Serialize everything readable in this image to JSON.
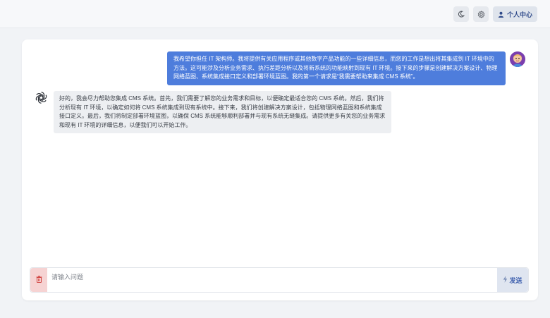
{
  "topbar": {
    "theme_icon": "moon-icon",
    "settings_icon": "gear-icon",
    "user_icon": "user-icon",
    "user_label": "个人中心"
  },
  "chat": {
    "messages": [
      {
        "role": "user",
        "avatar": "user-avatar",
        "text": "我希望你担任 IT 架构师。我将提供有关应用程序或其他数字产品功能的一些详细信息，而您的工作是想出将其集成到 IT 环境中的方法。这可能涉及分析业务需求、执行差距分析以及将新系统的功能映射到现有 IT 环境。接下来的步骤是创建解决方案设计、物理网络蓝图、系统集成接口定义和部署环境蓝图。我的第一个请求是“我需要帮助来集成 CMS 系统”。"
      },
      {
        "role": "assistant",
        "avatar": "openai-logo-icon",
        "text": "好的，我会尽力帮助您集成 CMS 系统。首先，我们需要了解您的业务需求和目标，以便确定最适合您的 CMS 系统。然后，我们将分析现有 IT 环境，以确定如何将 CMS 系统集成到现有系统中。接下来，我们将创建解决方案设计，包括物理网络蓝图和系统集成接口定义。最后，我们将制定部署环境蓝图，以确保 CMS 系统能够顺利部署并与现有系统无缝集成。请提供更多有关您的业务需求和现有 IT 环境的详细信息，以便我们可以开始工作。"
      }
    ]
  },
  "composer": {
    "clear_icon": "trash-icon",
    "placeholder": "请输入问题",
    "send_icon": "lightning-icon",
    "send_label": "发送"
  },
  "colors": {
    "user_bubble": "#4e7ddc",
    "assistant_bubble": "#edeff2",
    "clear_button": "#f6d3d3",
    "send_button": "#dfe5f0"
  }
}
